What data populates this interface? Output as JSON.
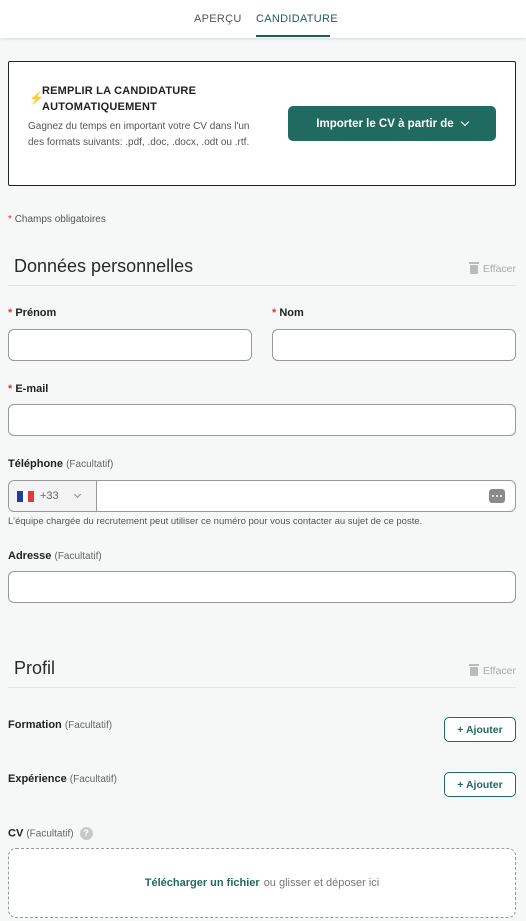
{
  "tabs": [
    {
      "label": "APERÇU"
    },
    {
      "label": "CANDIDATURE"
    }
  ],
  "autofill": {
    "icon": "bolt-icon",
    "title": "REMPLIR LA CANDIDATURE AUTOMATIQUEMENT",
    "description": "Gagnez du temps en important votre CV dans l'un des formats suivants: .pdf, .doc, .docx, .odt ou .rtf.",
    "import_button": "Importer le CV à partir de"
  },
  "required_note": {
    "star": "*",
    "text": "Champs obligatoires"
  },
  "personal": {
    "title": "Données personnelles",
    "clear_label": "Effacer",
    "first_name": {
      "label": "Prénom",
      "value": ""
    },
    "last_name": {
      "label": "Nom",
      "value": ""
    },
    "email": {
      "label": "E-mail",
      "value": ""
    },
    "phone": {
      "label": "Téléphone",
      "optional": "(Facultatif)",
      "country_code": "+33",
      "value": "",
      "help": "L'équipe chargée du recrutement peut utiliser ce numéro pour vous contacter au sujet de ce poste."
    },
    "address": {
      "label": "Adresse",
      "optional": "(Facultatif)",
      "value": ""
    }
  },
  "profile": {
    "title": "Profil",
    "clear_label": "Effacer",
    "education": {
      "label": "Formation",
      "optional": "(Facultatif)",
      "button": "+ Ajouter"
    },
    "experience": {
      "label": "Expérience",
      "optional": "(Facultatif)",
      "button": "+ Ajouter"
    },
    "cv": {
      "label": "CV",
      "optional": "(Facultatif)",
      "help_icon": "?",
      "upload_link": "Télécharger un fichier",
      "upload_hint": "ou glisser et déposer ici"
    }
  },
  "colors": {
    "accent": "#216a5f",
    "required": "#d13b3b"
  }
}
